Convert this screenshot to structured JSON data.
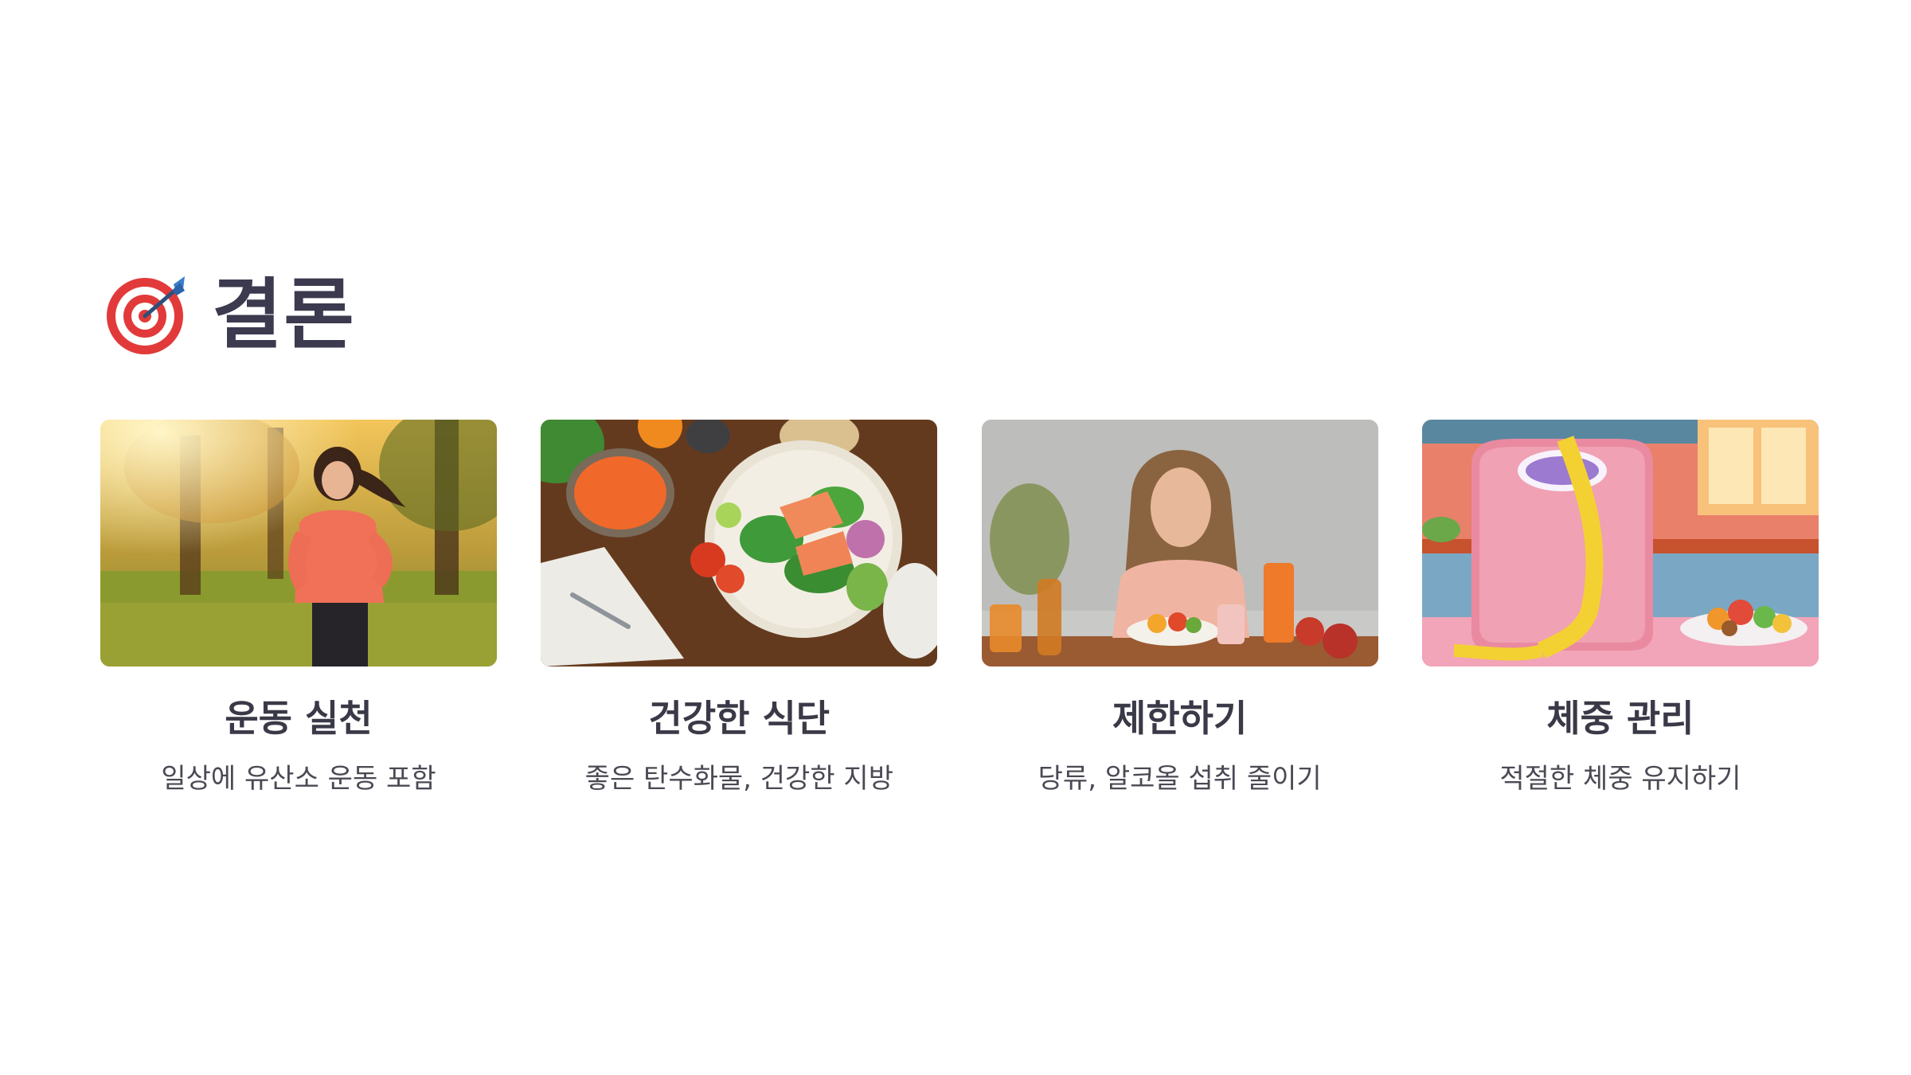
{
  "header": {
    "icon": "target-icon",
    "title": "결론"
  },
  "cards": [
    {
      "title": "운동 실천",
      "description": "일상에 유산소 운동 포함",
      "image": "jogging-woman-park-image"
    },
    {
      "title": "건강한 식단",
      "description": "좋은 탄수화물, 건강한 지방",
      "image": "salmon-salad-bowl-image"
    },
    {
      "title": "제한하기",
      "description": "당류, 알코올 섭취 줄이기",
      "image": "smiling-woman-table-image"
    },
    {
      "title": "체중 관리",
      "description": "적절한 체중 유지하기",
      "image": "bathroom-scale-tape-image"
    }
  ],
  "colors": {
    "title": "#3b3a4f",
    "card_title": "#3a3947",
    "card_desc": "#4a4a55",
    "target_red": "#e23a3a"
  }
}
